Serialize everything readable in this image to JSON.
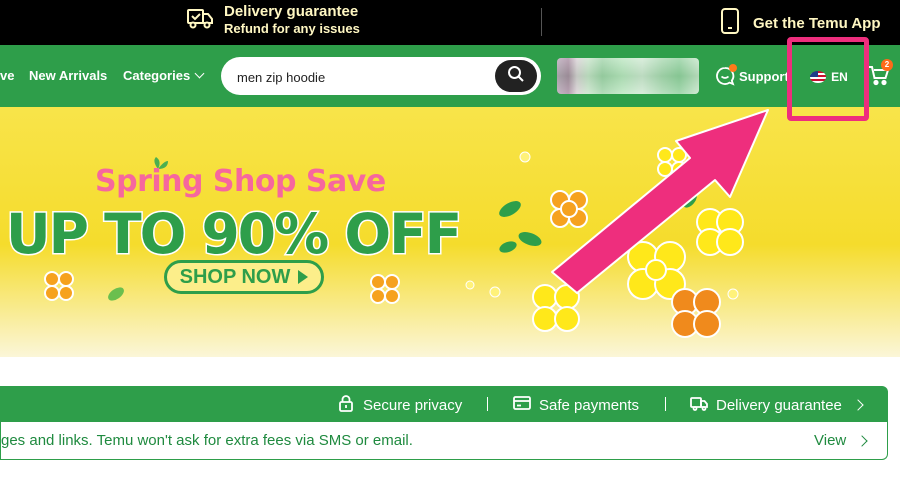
{
  "topbar": {
    "delivery_title": "Delivery guarantee",
    "delivery_sub": "Refund for any issues",
    "app_label": "Get the Temu App"
  },
  "nav": {
    "items": [
      "ve",
      "New Arrivals",
      "Categories"
    ],
    "search_value": "men zip hoodie",
    "support_label": "Support",
    "language": "EN",
    "cart_count": "2"
  },
  "banner": {
    "headline": "Spring Shop Save",
    "offer": "UP TO 90% OFF",
    "cta": "SHOP NOW"
  },
  "trust": {
    "items": [
      "Secure privacy",
      "Safe payments",
      "Delivery guarantee"
    ]
  },
  "notice": {
    "text": "ges and links. Temu won't ask for extra fees via SMS or email.",
    "view_label": "View"
  },
  "colors": {
    "brand_green": "#2e9e4a",
    "highlight_pink": "#ee2e7d",
    "banner_yellow": "#f5dc2c",
    "headline_pink": "#f6679e"
  }
}
